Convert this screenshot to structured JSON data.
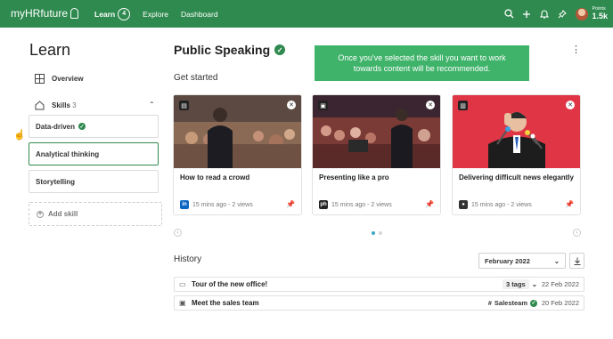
{
  "app": {
    "logo_text": "myHRfuture",
    "nav": [
      {
        "label": "Learn",
        "badge": "4"
      },
      {
        "label": "Explore"
      },
      {
        "label": "Dashboard"
      }
    ],
    "points_label": "Points",
    "points_value": "1.5k"
  },
  "sidebar": {
    "title": "Learn",
    "overview_label": "Overview",
    "skills_label": "Skills",
    "skills_count": "3",
    "skills": [
      {
        "label": "Data-driven",
        "verified": true
      },
      {
        "label": "Analytical thinking",
        "selected": true
      },
      {
        "label": "Storytelling"
      }
    ],
    "add_skill_label": "Add skill"
  },
  "main": {
    "title": "Public Speaking",
    "tooltip": "Once you've selected the skill you want to work towards content will be recommended.",
    "get_started_label": "Get started",
    "cards": [
      {
        "title": "How to read a crowd",
        "meta": "15 mins ago - 2 views",
        "source_icon": "linkedin-icon",
        "source_text": "in",
        "source_color": "#0a66c2"
      },
      {
        "title": "Presenting like a pro",
        "meta": "15 mins ago - 2 views",
        "source_icon": "source-icon",
        "source_text": "ph",
        "source_color": "#222222"
      },
      {
        "title": "Delivering difficult news elegantly",
        "meta": "15 mins ago - 2 views",
        "source_icon": "source-icon",
        "source_text": "●",
        "source_color": "#333333"
      }
    ],
    "history_label": "History",
    "month_select": "February 2022",
    "history": [
      {
        "title": "Tour of the new office!",
        "tag": "3 tags",
        "date": "22 Feb 2022"
      },
      {
        "title": "Meet the sales team",
        "tag": "Salesteam",
        "date": "20 Feb 2022"
      }
    ]
  },
  "colors": {
    "brand_green": "#2f8a4f",
    "tooltip_green": "#40b36b",
    "dot_active": "#3aa8c9"
  }
}
